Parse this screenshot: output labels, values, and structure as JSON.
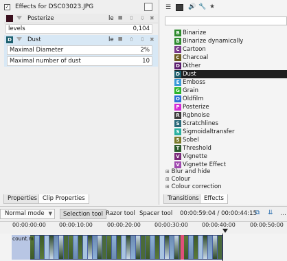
{
  "effect_stack": {
    "title": "Effects for DSC03023.JPG",
    "effects": [
      {
        "name": "Posterize",
        "param_label": "levels",
        "param_value": "0,104",
        "letter": ""
      },
      {
        "name": "Dust",
        "letter": "D",
        "params": [
          {
            "label": "Maximal Diameter",
            "value": "2%"
          },
          {
            "label": "Maximal number of dust",
            "value": "10"
          }
        ]
      }
    ],
    "le_label": "le"
  },
  "left_tabs": [
    "Properties",
    "Clip Properties"
  ],
  "right_tabs": [
    "Transitions",
    "Effects"
  ],
  "effects_list": [
    {
      "letter": "B",
      "label": "Binarize",
      "color": "#2e8b2e"
    },
    {
      "letter": "B",
      "label": "Binarize dynamically",
      "color": "#2e8b2e"
    },
    {
      "letter": "C",
      "label": "Cartoon",
      "color": "#7a3a8a"
    },
    {
      "letter": "C",
      "label": "Charcoal",
      "color": "#6b5b1f"
    },
    {
      "letter": "D",
      "label": "Dither",
      "color": "#5b1c6e"
    },
    {
      "letter": "D",
      "label": "Dust",
      "color": "#1c5f6e"
    },
    {
      "letter": "E",
      "label": "Emboss",
      "color": "#3a9ad9"
    },
    {
      "letter": "G",
      "label": "Grain",
      "color": "#2bb52b"
    },
    {
      "letter": "O",
      "label": "Oldfilm",
      "color": "#2b6fd4"
    },
    {
      "letter": "P",
      "label": "Posterize",
      "color": "#d42bd4"
    },
    {
      "letter": "R",
      "label": "Rgbnoise",
      "color": "#3a3a3a"
    },
    {
      "letter": "S",
      "label": "Scratchlines",
      "color": "#2a6a7a"
    },
    {
      "letter": "S",
      "label": "Sigmoidaltransfer",
      "color": "#2ab0a0"
    },
    {
      "letter": "S",
      "label": "Sobel",
      "color": "#7a7a2a"
    },
    {
      "letter": "T",
      "label": "Threshold",
      "color": "#2a5a2a"
    },
    {
      "letter": "V",
      "label": "Vignette",
      "color": "#7a2a7a"
    },
    {
      "letter": "V",
      "label": "Vignette Effect",
      "color": "#a04ab0"
    }
  ],
  "categories": [
    "Blur and hide",
    "Colour",
    "Colour correction"
  ],
  "selected_effect": "Dust",
  "toolbar": {
    "mode": "Normal mode",
    "selection_tool": "Selection tool",
    "razor_tool": "Razor tool",
    "spacer_tool": "Spacer tool",
    "timecode": "00:00:59:04 / 00:00:44:15"
  },
  "ruler": [
    "00:00:00:00",
    "00:00:10:00",
    "00:00:20:00",
    "00:00:30:00",
    "00:00:40:00",
    "00:00:50:00"
  ],
  "clip_label": "count.m"
}
